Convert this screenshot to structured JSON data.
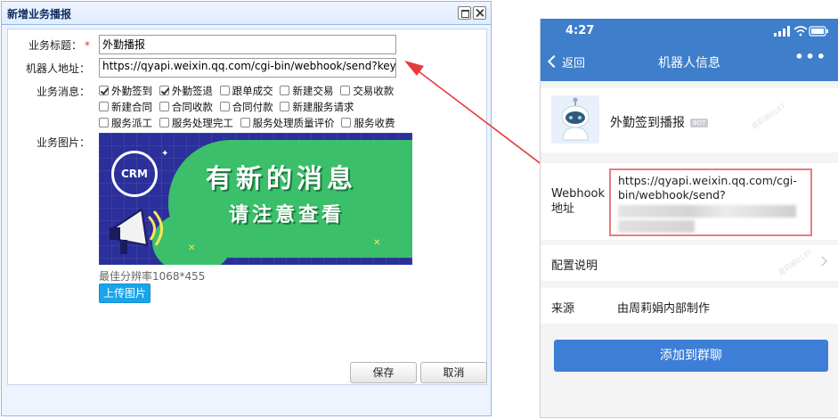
{
  "dialog": {
    "title": "新增业务播报",
    "fields": {
      "title_label": "业务标题：",
      "title_value": "外勤播报",
      "robot_label": "机器人地址：",
      "robot_value": "https://qyapi.weixin.qq.com/cgi-bin/webhook/send?key=",
      "messages_label": "业务消息：",
      "image_label": "业务图片："
    },
    "checkboxes": [
      {
        "label": "外勤签到",
        "checked": true
      },
      {
        "label": "外勤签退",
        "checked": true
      },
      {
        "label": "跟单成交",
        "checked": false
      },
      {
        "label": "新建交易",
        "checked": false
      },
      {
        "label": "交易收款",
        "checked": false
      },
      {
        "label": "新建合同",
        "checked": false
      },
      {
        "label": "合同收款",
        "checked": false
      },
      {
        "label": "合同付款",
        "checked": false
      },
      {
        "label": "新建服务请求",
        "checked": false
      },
      {
        "label": "服务派工",
        "checked": false
      },
      {
        "label": "服务处理完工",
        "checked": false
      },
      {
        "label": "服务处理质量评价",
        "checked": false
      },
      {
        "label": "服务收费",
        "checked": false
      }
    ],
    "banner": {
      "logo": "CRM",
      "line1": "有新的消息",
      "line2": "请注意查看"
    },
    "resolution_hint": "最佳分辨率1068*455",
    "upload_label": "上传图片",
    "save_label": "保存",
    "cancel_label": "取消",
    "required_mark": "*"
  },
  "phone": {
    "time": "4:27",
    "back_label": "返回",
    "title": "机器人信息",
    "more": "•••",
    "bot_name": "外勤签到播报",
    "bot_badge": "BOT",
    "webhook_label": "Webhook 地址",
    "webhook_value": "https://qyapi.weixin.qq.com/cgi-bin/webhook/send?",
    "config_label": "配置说明",
    "source_label": "来源",
    "source_value": "由周莉娟内部制作",
    "add_button": "添加到群聊",
    "watermark": "周莉娟0187"
  },
  "colors": {
    "accent_blue": "#3e7ecb",
    "highlight_red": "#e97c7c",
    "arrow_red": "#e83b3b",
    "upload_blue": "#1aa4ea"
  }
}
